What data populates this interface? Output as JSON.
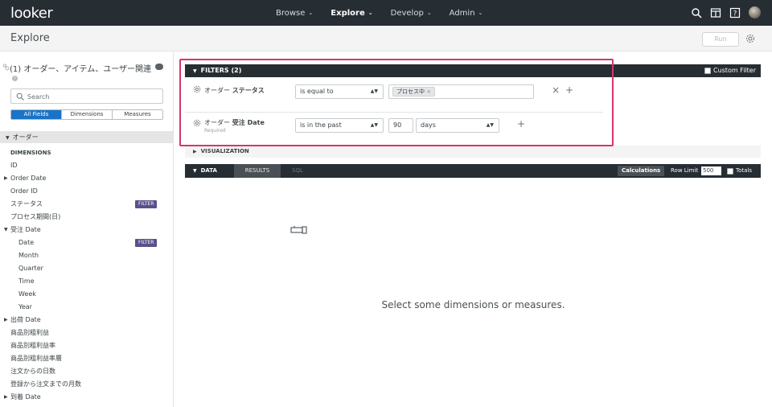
{
  "nav": {
    "logo": "looker",
    "links": [
      {
        "label": "Browse",
        "active": false
      },
      {
        "label": "Explore",
        "active": true
      },
      {
        "label": "Develop",
        "active": false
      },
      {
        "label": "Admin",
        "active": false
      }
    ]
  },
  "header": {
    "title": "Explore",
    "run_label": "Run"
  },
  "sidebar": {
    "model_title": "(1) オーダー、アイテム、ユーザー関連",
    "search_placeholder": "Search",
    "tabs": [
      "All Fields",
      "Dimensions",
      "Measures"
    ],
    "view_name": "オーダー",
    "dimensions_header": "DIMENSIONS",
    "fields": [
      {
        "label": "ID"
      },
      {
        "label": "Order Date"
      },
      {
        "label": "Order ID"
      },
      {
        "label": "ステータス",
        "filter": "FILTER"
      },
      {
        "label": "プロセス期間(日)"
      },
      {
        "label": "受注 Date"
      },
      {
        "label": "Date",
        "filter": "FILTER"
      },
      {
        "label": "Month"
      },
      {
        "label": "Quarter"
      },
      {
        "label": "Time"
      },
      {
        "label": "Week"
      },
      {
        "label": "Year"
      },
      {
        "label": "出荷 Date"
      },
      {
        "label": "商品別粗利益"
      },
      {
        "label": "商品別粗利益率"
      },
      {
        "label": "商品別粗利益率層"
      },
      {
        "label": "注文からの日数"
      },
      {
        "label": "登録から注文までの月数"
      },
      {
        "label": "到着 Date"
      }
    ]
  },
  "filters": {
    "header": "FILTERS (2)",
    "custom_filter": "Custom Filter",
    "rows": [
      {
        "view": "オーダー",
        "field": "ステータス",
        "operator": "is equal to",
        "value_chip": "プロセス中"
      },
      {
        "view": "オーダー",
        "field": "受注 Date",
        "required": "Required",
        "operator": "is in the past",
        "number": "90",
        "unit": "days"
      }
    ]
  },
  "visualization": {
    "label": "VISUALIZATION"
  },
  "data": {
    "label": "DATA",
    "tab_results": "RESULTS",
    "tab_sql": "SQL",
    "calculations": "Calculations",
    "row_limit_label": "Row Limit",
    "row_limit_value": "500",
    "totals_label": "Totals"
  },
  "empty_state": "Select some dimensions or measures.",
  "colors": {
    "nav_bg": "#262d33",
    "accent": "#1a73c7",
    "filter_tag": "#5b4f8c",
    "highlight": "#d6366c"
  }
}
